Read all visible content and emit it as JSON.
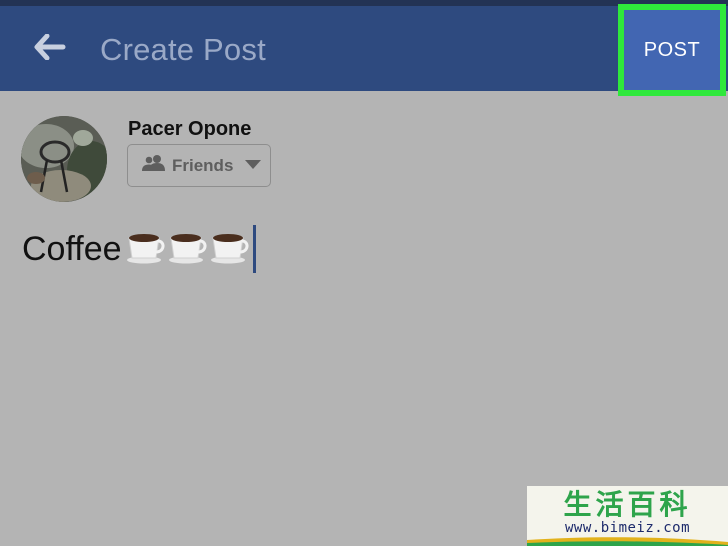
{
  "header": {
    "title": "Create Post",
    "back_icon": "arrow-left-icon",
    "post_label": "POST"
  },
  "composer": {
    "user_name": "Pacer Opone",
    "audience_label": "Friends",
    "audience_icon": "friends-icon",
    "dropdown_icon": "caret-down-icon",
    "text": "Coffee",
    "emoji_icons": [
      "coffee-cup-icon",
      "coffee-cup-icon",
      "coffee-cup-icon"
    ]
  },
  "watermark": {
    "cjk": "生活百科",
    "url": "www.bimeiz.com"
  },
  "colors": {
    "header_bg": "#2e4a7f",
    "highlight": "#2fe83c",
    "post_button_bg": "#4266b2",
    "page_bg": "#b4b4b4"
  }
}
